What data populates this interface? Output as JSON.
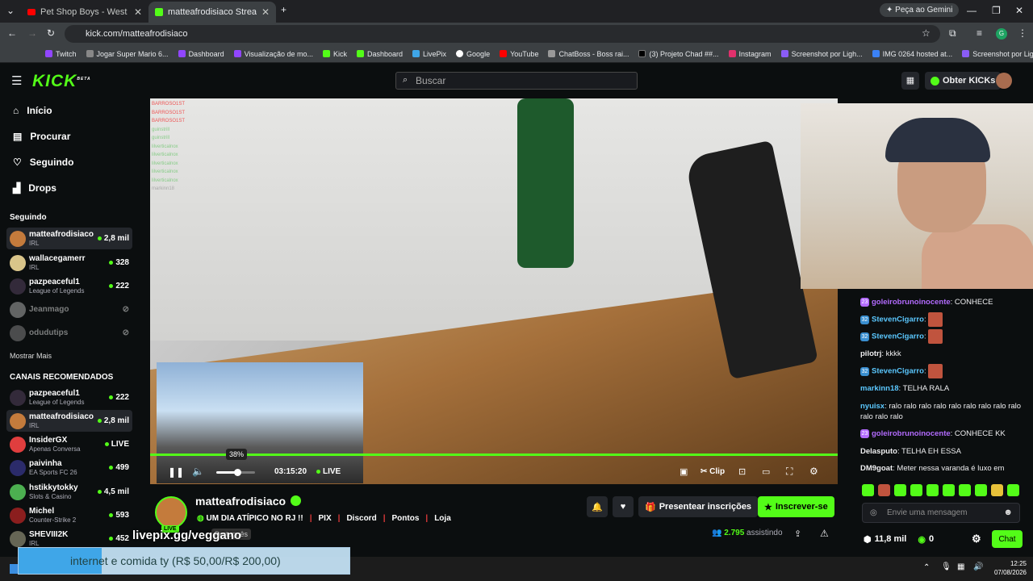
{
  "browser": {
    "tabs": [
      {
        "label": "Pet Shop Boys - West End Girls",
        "icon": "youtube-icon"
      },
      {
        "label": "matteafrodisiaco Stream - ",
        "icon": "kick-icon"
      }
    ],
    "gemini_label": "Peça ao Gemini",
    "url": "kick.com/matteafrodisiaco",
    "bookmarks": [
      "Twitch",
      "Jogar Super Mario 6...",
      "Dashboard",
      "Visualização de mo...",
      "Kick",
      "Dashboard",
      "LivePix",
      "Google",
      "YouTube",
      "ChatBoss - Boss rai...",
      "(3) Projeto Chad ##...",
      "Instagram",
      "Screenshot por Ligh...",
      "IMG 0264 hosted at...",
      "Screenshot por Ligh..."
    ]
  },
  "header": {
    "logo": "KICK",
    "logo_beta": "BETA",
    "search_placeholder": "Buscar",
    "get_kicks": "Obter KICKs"
  },
  "sidebar": {
    "nav": [
      "Início",
      "Procurar",
      "Seguindo",
      "Drops"
    ],
    "following_title": "Seguindo",
    "following": [
      {
        "name": "matteafrodisiaco",
        "category": "IRL",
        "count": "2,8 mil",
        "online": true
      },
      {
        "name": "wallacegamerr",
        "category": "IRL",
        "count": "328",
        "online": true
      },
      {
        "name": "pazpeaceful1",
        "category": "League of Legends",
        "count": "222",
        "online": true
      },
      {
        "name": "Jeanmago",
        "category": "",
        "count": "",
        "online": false
      },
      {
        "name": "odudutips",
        "category": "",
        "count": "",
        "online": false
      }
    ],
    "show_more": "Mostrar Mais",
    "recommended_title": "CANAIS RECOMENDADOS",
    "recommended": [
      {
        "name": "pazpeaceful1",
        "category": "League of Legends",
        "count": "222"
      },
      {
        "name": "matteafrodisiaco",
        "category": "IRL",
        "count": "2,8 mil"
      },
      {
        "name": "InsiderGX",
        "category": "Apenas Conversa",
        "count": "LIVE"
      },
      {
        "name": "paivinha",
        "category": "EA Sports FC 26",
        "count": "499"
      },
      {
        "name": "hstikkytokky",
        "category": "Slots & Casino",
        "count": "4,5 mil"
      },
      {
        "name": "Michel",
        "category": "Counter-Strike 2",
        "count": "593"
      },
      {
        "name": "SHEVIII2K",
        "category": "IRL",
        "count": "452"
      }
    ]
  },
  "player": {
    "volume_tooltip": "38%",
    "time": "03:15:20",
    "live": "LIVE",
    "clip": "Clip",
    "overlay_chat": [
      "BARROSO1ST",
      "BARROSO1ST",
      "BARROSO1ST",
      "guinstrill",
      "guinstrill",
      "lilverticalnox",
      "lilverticalnox",
      "lilverticalnox",
      "lilverticalnox",
      "lilverticalnox",
      "markinn18"
    ]
  },
  "stream": {
    "streamer": "matteafrodisiaco",
    "avatar_live": "LIVE",
    "title": "UM DIA ATÍPICO NO RJ !!",
    "links": [
      "PIX",
      "Discord",
      "Pontos",
      "Loja"
    ],
    "language": "Português",
    "gift_subs": "Presentear inscrições",
    "subscribe": "Inscrever-se",
    "viewers": "2.795",
    "viewers_label": "assistindo"
  },
  "overlay": {
    "livepix": "livepix.gg/veggano",
    "donation_text": "internet e comida ty (R$ 50,00/R$ 200,00)",
    "donation_progress": 0.25
  },
  "chat": {
    "messages": [
      {
        "user": "goleirobrunoinocente",
        "text": "CONHECE",
        "color": "#b36bff"
      },
      {
        "user": "StevenCigarro",
        "text": "",
        "color": "#5bc8ff"
      },
      {
        "user": "StevenCigarro",
        "text": "",
        "color": "#5bc8ff"
      },
      {
        "user": "pilotrj",
        "text": "kkkk",
        "color": "#efeff1"
      },
      {
        "user": "StevenCigarro",
        "text": "",
        "color": "#5bc8ff"
      },
      {
        "user": "markinn18",
        "text": "TELHA RALA",
        "color": "#5bc8ff"
      },
      {
        "user": "nyuisx",
        "text": "ralo ralo ralo ralo ralo ralo ralo ralo ralo ralo ralo ralo",
        "color": "#5bc8ff"
      },
      {
        "user": "goleirobrunoinocente",
        "text": "CONHECE KK",
        "color": "#b36bff"
      },
      {
        "user": "Delasputo",
        "text": "TELHA EH ESSA",
        "color": "#efeff1"
      },
      {
        "user": "DM9goat",
        "text": "Meter nessa varanda é luxo em",
        "color": "#efeff1"
      }
    ],
    "input_placeholder": "Envie uma mensagem",
    "points": "11,8 mil",
    "kicks": "0",
    "chat_button": "Chat"
  },
  "taskbar": {
    "time": "12:25",
    "date": "07/08/2026"
  }
}
